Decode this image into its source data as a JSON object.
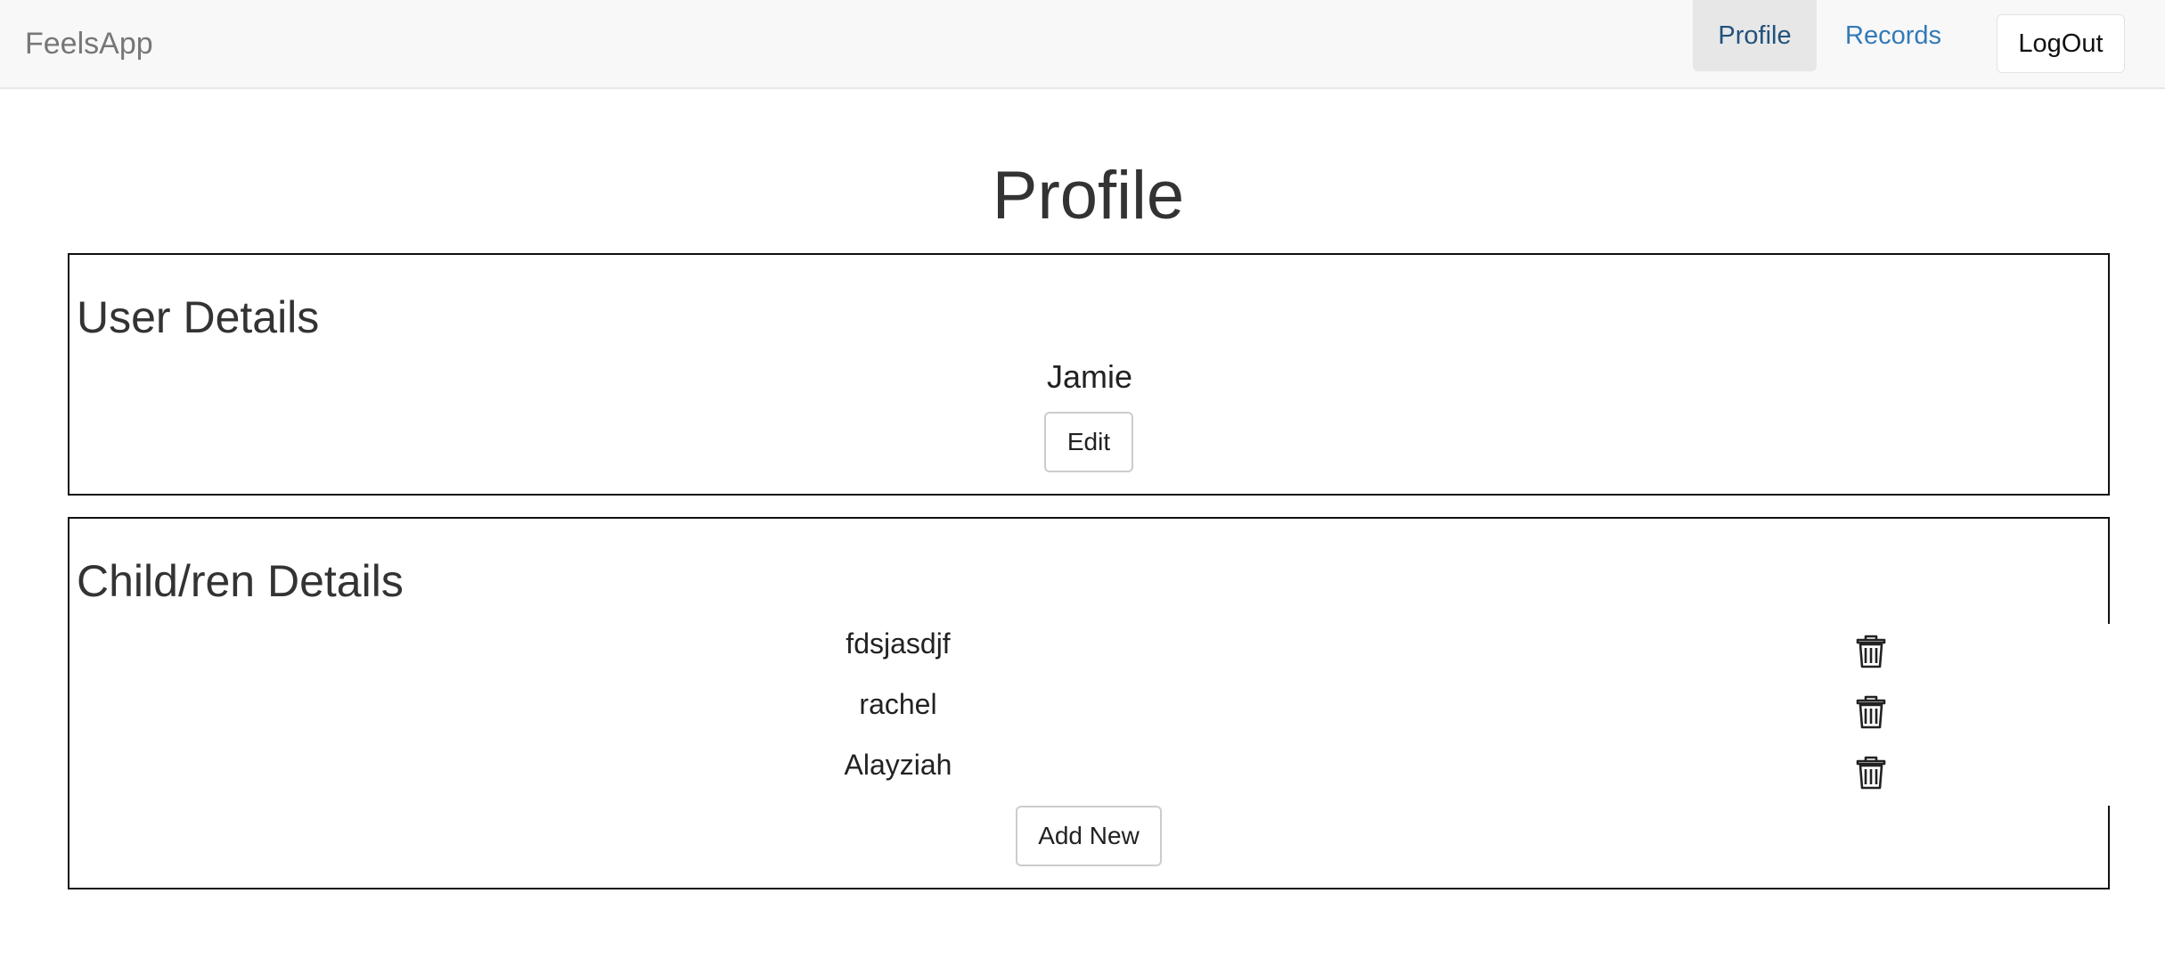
{
  "navbar": {
    "brand": "FeelsApp",
    "links": [
      {
        "label": "Profile",
        "active": true
      },
      {
        "label": "Records",
        "active": false
      }
    ],
    "logout_label": "LogOut"
  },
  "page": {
    "title": "Profile"
  },
  "user_details": {
    "title": "User Details",
    "name": "Jamie",
    "edit_label": "Edit"
  },
  "children_details": {
    "title": "Child/ren Details",
    "children": [
      {
        "name": "fdsjasdjf",
        "delete_icon": "trash-icon"
      },
      {
        "name": "rachel",
        "delete_icon": "trash-icon"
      },
      {
        "name": "Alayziah",
        "delete_icon": "trash-icon"
      }
    ],
    "add_label": "Add New"
  },
  "colors": {
    "navbar_bg": "#f8f8f8",
    "active_link": "#23527c",
    "link": "#337ab7",
    "border": "#111111"
  }
}
